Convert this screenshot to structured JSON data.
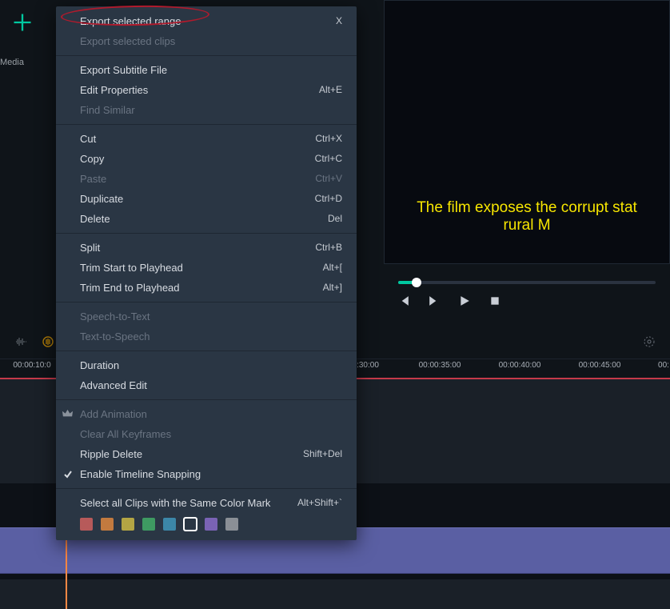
{
  "toolbar": {
    "media_label": "Media"
  },
  "preview": {
    "subtitle": "The film exposes the corrupt stat\nrural M"
  },
  "menu": {
    "export_selected_range": "Export selected range",
    "export_selected_range_sc": "X",
    "export_selected_clips": "Export selected clips",
    "export_subtitle_file": "Export Subtitle File",
    "edit_properties": "Edit Properties",
    "edit_properties_sc": "Alt+E",
    "find_similar": "Find Similar",
    "cut": "Cut",
    "cut_sc": "Ctrl+X",
    "copy": "Copy",
    "copy_sc": "Ctrl+C",
    "paste": "Paste",
    "paste_sc": "Ctrl+V",
    "duplicate": "Duplicate",
    "duplicate_sc": "Ctrl+D",
    "delete": "Delete",
    "delete_sc": "Del",
    "split": "Split",
    "split_sc": "Ctrl+B",
    "trim_start": "Trim Start to Playhead",
    "trim_start_sc": "Alt+[",
    "trim_end": "Trim End to Playhead",
    "trim_end_sc": "Alt+]",
    "speech_to_text": "Speech-to-Text",
    "text_to_speech": "Text-to-Speech",
    "duration": "Duration",
    "advanced_edit": "Advanced Edit",
    "add_animation": "Add Animation",
    "clear_keyframes": "Clear All Keyframes",
    "ripple_delete": "Ripple Delete",
    "ripple_delete_sc": "Shift+Del",
    "enable_snapping": "Enable Timeline Snapping",
    "select_same_color": "Select all Clips with the Same Color Mark",
    "select_same_color_sc": "Alt+Shift+`"
  },
  "colors": [
    "#b75a5a",
    "#c27a3f",
    "#b3a544",
    "#3e9a62",
    "#3c87a8",
    "#2b3fb0",
    "#7a63b5",
    "#8a8f96"
  ],
  "ruler": {
    "ticks": [
      {
        "label": "00:00:10:0",
        "pos": 40
      },
      {
        "label": ":30:00",
        "pos": 460
      },
      {
        "label": "00:00:35:00",
        "pos": 550
      },
      {
        "label": "00:00:40:00",
        "pos": 650
      },
      {
        "label": "00:00:45:00",
        "pos": 750
      },
      {
        "label": "00:",
        "pos": 830
      }
    ]
  }
}
